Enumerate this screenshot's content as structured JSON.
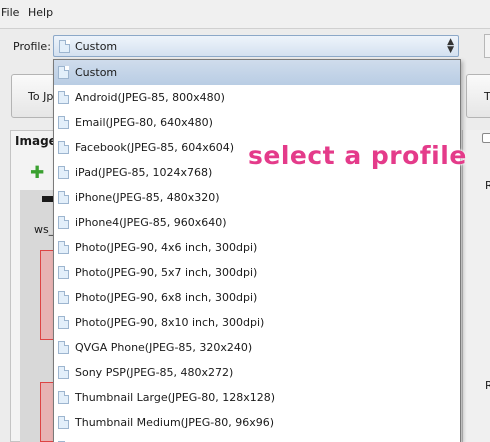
{
  "menubar": {
    "file": "File",
    "help": "Help"
  },
  "profile": {
    "label": "Profile:",
    "selected": "Custom",
    "options": [
      "Custom",
      "Android(JPEG-85, 800x480)",
      "Email(JPEG-80, 640x480)",
      "Facebook(JPEG-85, 604x604)",
      "iPad(JPEG-85, 1024x768)",
      "iPhone(JPEG-85, 480x320)",
      "iPhone4(JPEG-85, 960x640)",
      "Photo(JPEG-90, 4x6 inch, 300dpi)",
      "Photo(JPEG-90, 5x7 inch, 300dpi)",
      "Photo(JPEG-90, 6x8 inch, 300dpi)",
      "Photo(JPEG-90, 8x10 inch, 300dpi)",
      "QVGA Phone(JPEG-85, 320x240)",
      "Sony PSP(JPEG-85, 480x272)",
      "Thumbnail Large(JPEG-80, 128x128)",
      "Thumbnail Medium(JPEG-80, 96x96)"
    ]
  },
  "background": {
    "to_button": "To Jp",
    "right_button": "T",
    "image_panel_title": "Image",
    "thumb_text": "ws_",
    "right_label_1": "R",
    "right_label_2": "R"
  },
  "annotation": "select a profile",
  "colors": {
    "annotation": "#e43b8a",
    "selection": "#c3d4e8"
  }
}
